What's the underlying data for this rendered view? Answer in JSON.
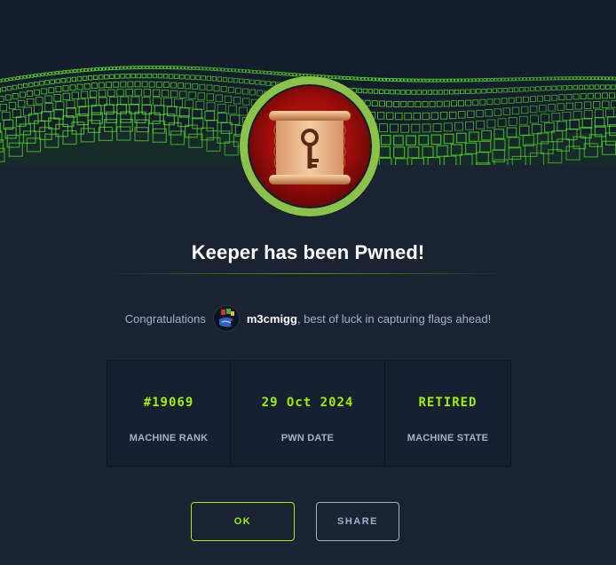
{
  "machine": {
    "name": "Keeper",
    "title": "Keeper has been Pwned!"
  },
  "congrats": {
    "prefix": "Congratulations",
    "username": "m3cmigg",
    "suffix": ", best of luck in capturing flags ahead!"
  },
  "stats": [
    {
      "value": "#19069",
      "label": "MACHINE RANK"
    },
    {
      "value": "29 Oct 2024",
      "label": "PWN DATE"
    },
    {
      "value": "RETIRED",
      "label": "MACHINE STATE"
    }
  ],
  "buttons": {
    "ok_label": "OK",
    "share_label": "SHARE"
  },
  "icons": {
    "machine_avatar": "scroll-key-icon",
    "user_avatar": "user-avatar-icon"
  },
  "colors": {
    "accent": "#9fef00",
    "background": "#1a2332",
    "muted_text": "#a4b1cd",
    "ring": "#8bc34a",
    "avatar_red": "#a00d0a"
  }
}
